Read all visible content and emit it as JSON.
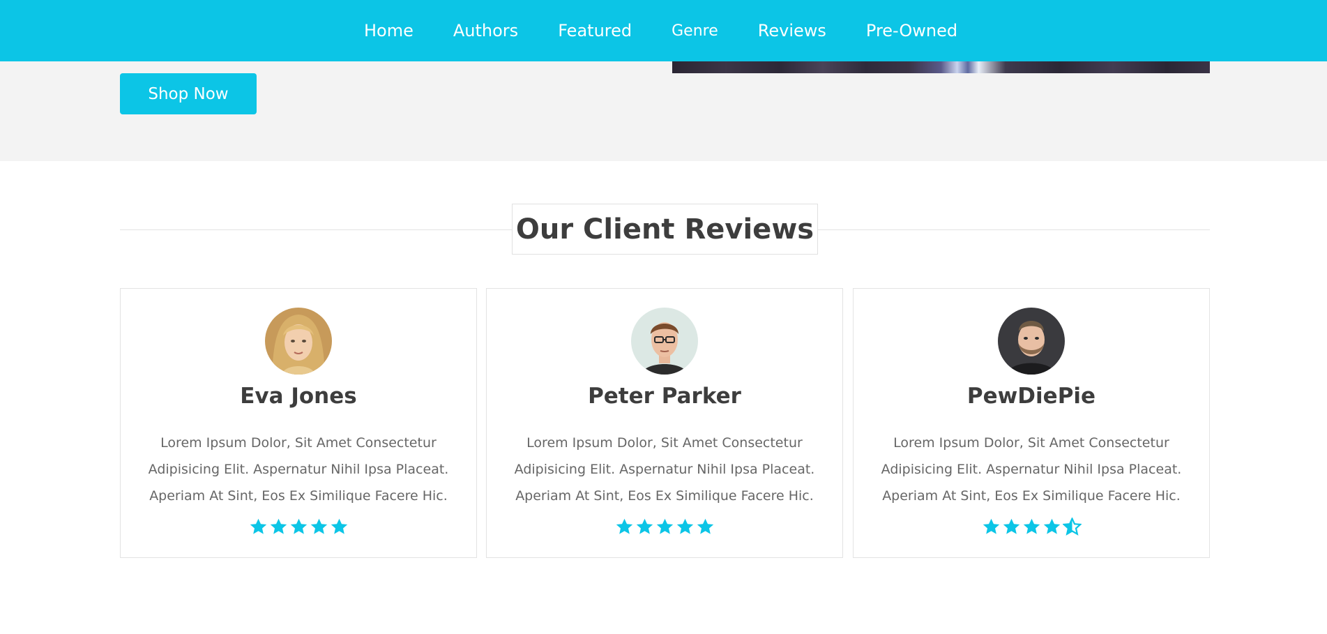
{
  "nav": {
    "links": [
      "Home",
      "Authors",
      "Featured",
      "Genre",
      "Reviews",
      "Pre-Owned"
    ]
  },
  "hero": {
    "cta_label": "Shop Now"
  },
  "reviews_section": {
    "title": "Our Client Reviews",
    "reviews": [
      {
        "name": "Eva Jones",
        "text": "Lorem Ipsum Dolor, Sit Amet Consectetur Adipisicing Elit. Aspernatur Nihil Ipsa Placeat. Aperiam At Sint, Eos Ex Similique Facere Hic.",
        "rating": 5,
        "avatar": "avatar-blonde-woman"
      },
      {
        "name": "Peter Parker",
        "text": "Lorem Ipsum Dolor, Sit Amet Consectetur Adipisicing Elit. Aspernatur Nihil Ipsa Placeat. Aperiam At Sint, Eos Ex Similique Facere Hic.",
        "rating": 5,
        "avatar": "avatar-man-glasses"
      },
      {
        "name": "PewDiePie",
        "text": "Lorem Ipsum Dolor, Sit Amet Consectetur Adipisicing Elit. Aspernatur Nihil Ipsa Placeat. Aperiam At Sint, Eos Ex Similique Facere Hic.",
        "rating": 4.5,
        "avatar": "avatar-bearded-man"
      }
    ]
  },
  "colors": {
    "accent": "#0cc5e6",
    "hero_bg": "#f3f3f3",
    "heading_text": "#3d3d3d",
    "body_text": "#666666",
    "border": "#e3e3e3"
  },
  "icons": {
    "full_star": "star-icon",
    "half_star": "star-half-icon"
  }
}
